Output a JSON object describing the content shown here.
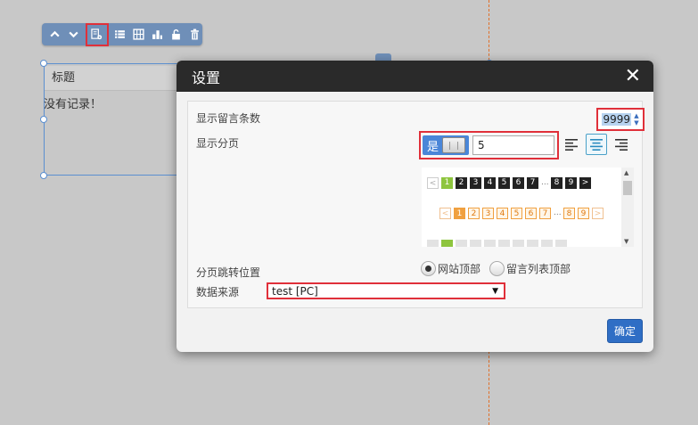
{
  "canvas": {
    "widget_title": "标题",
    "widget_empty": "没有记录！"
  },
  "toolbar": {
    "icons": [
      "chevron-up-icon",
      "chevron-down-icon",
      "settings-icon",
      "list-icon",
      "grid-icon",
      "chart-icon",
      "unlock-icon",
      "trash-icon"
    ]
  },
  "dialog": {
    "title": "设置",
    "close_label": "✕",
    "message_count_label": "显示留言条数",
    "message_count_value": "9999",
    "pagination_label": "显示分页",
    "pagination_toggle_label": "是",
    "pagination_value": "5",
    "align_options": [
      "align-left-icon",
      "align-center-icon",
      "align-right-icon"
    ],
    "align_selected": "align-center-icon",
    "pager_styles": {
      "dark": [
        "<",
        "1",
        "2",
        "3",
        "4",
        "5",
        "6",
        "7",
        "...",
        "8",
        "9",
        ">"
      ],
      "orange": [
        "<",
        "1",
        "2",
        "3",
        "4",
        "5",
        "6",
        "7",
        "...",
        "8",
        "9",
        ">"
      ]
    },
    "jump_position_label": "分页跳转位置",
    "jump_options": [
      "网站顶部",
      "留言列表顶部"
    ],
    "jump_selected": "网站顶部",
    "data_source_label": "数据来源",
    "data_source_value": "test [PC]",
    "confirm_label": "确定"
  },
  "colors": {
    "accent": "#2f6ec5",
    "highlight": "#e0303a",
    "toolbar": "#6f8fb8",
    "header_dark": "#2a2a2a"
  }
}
